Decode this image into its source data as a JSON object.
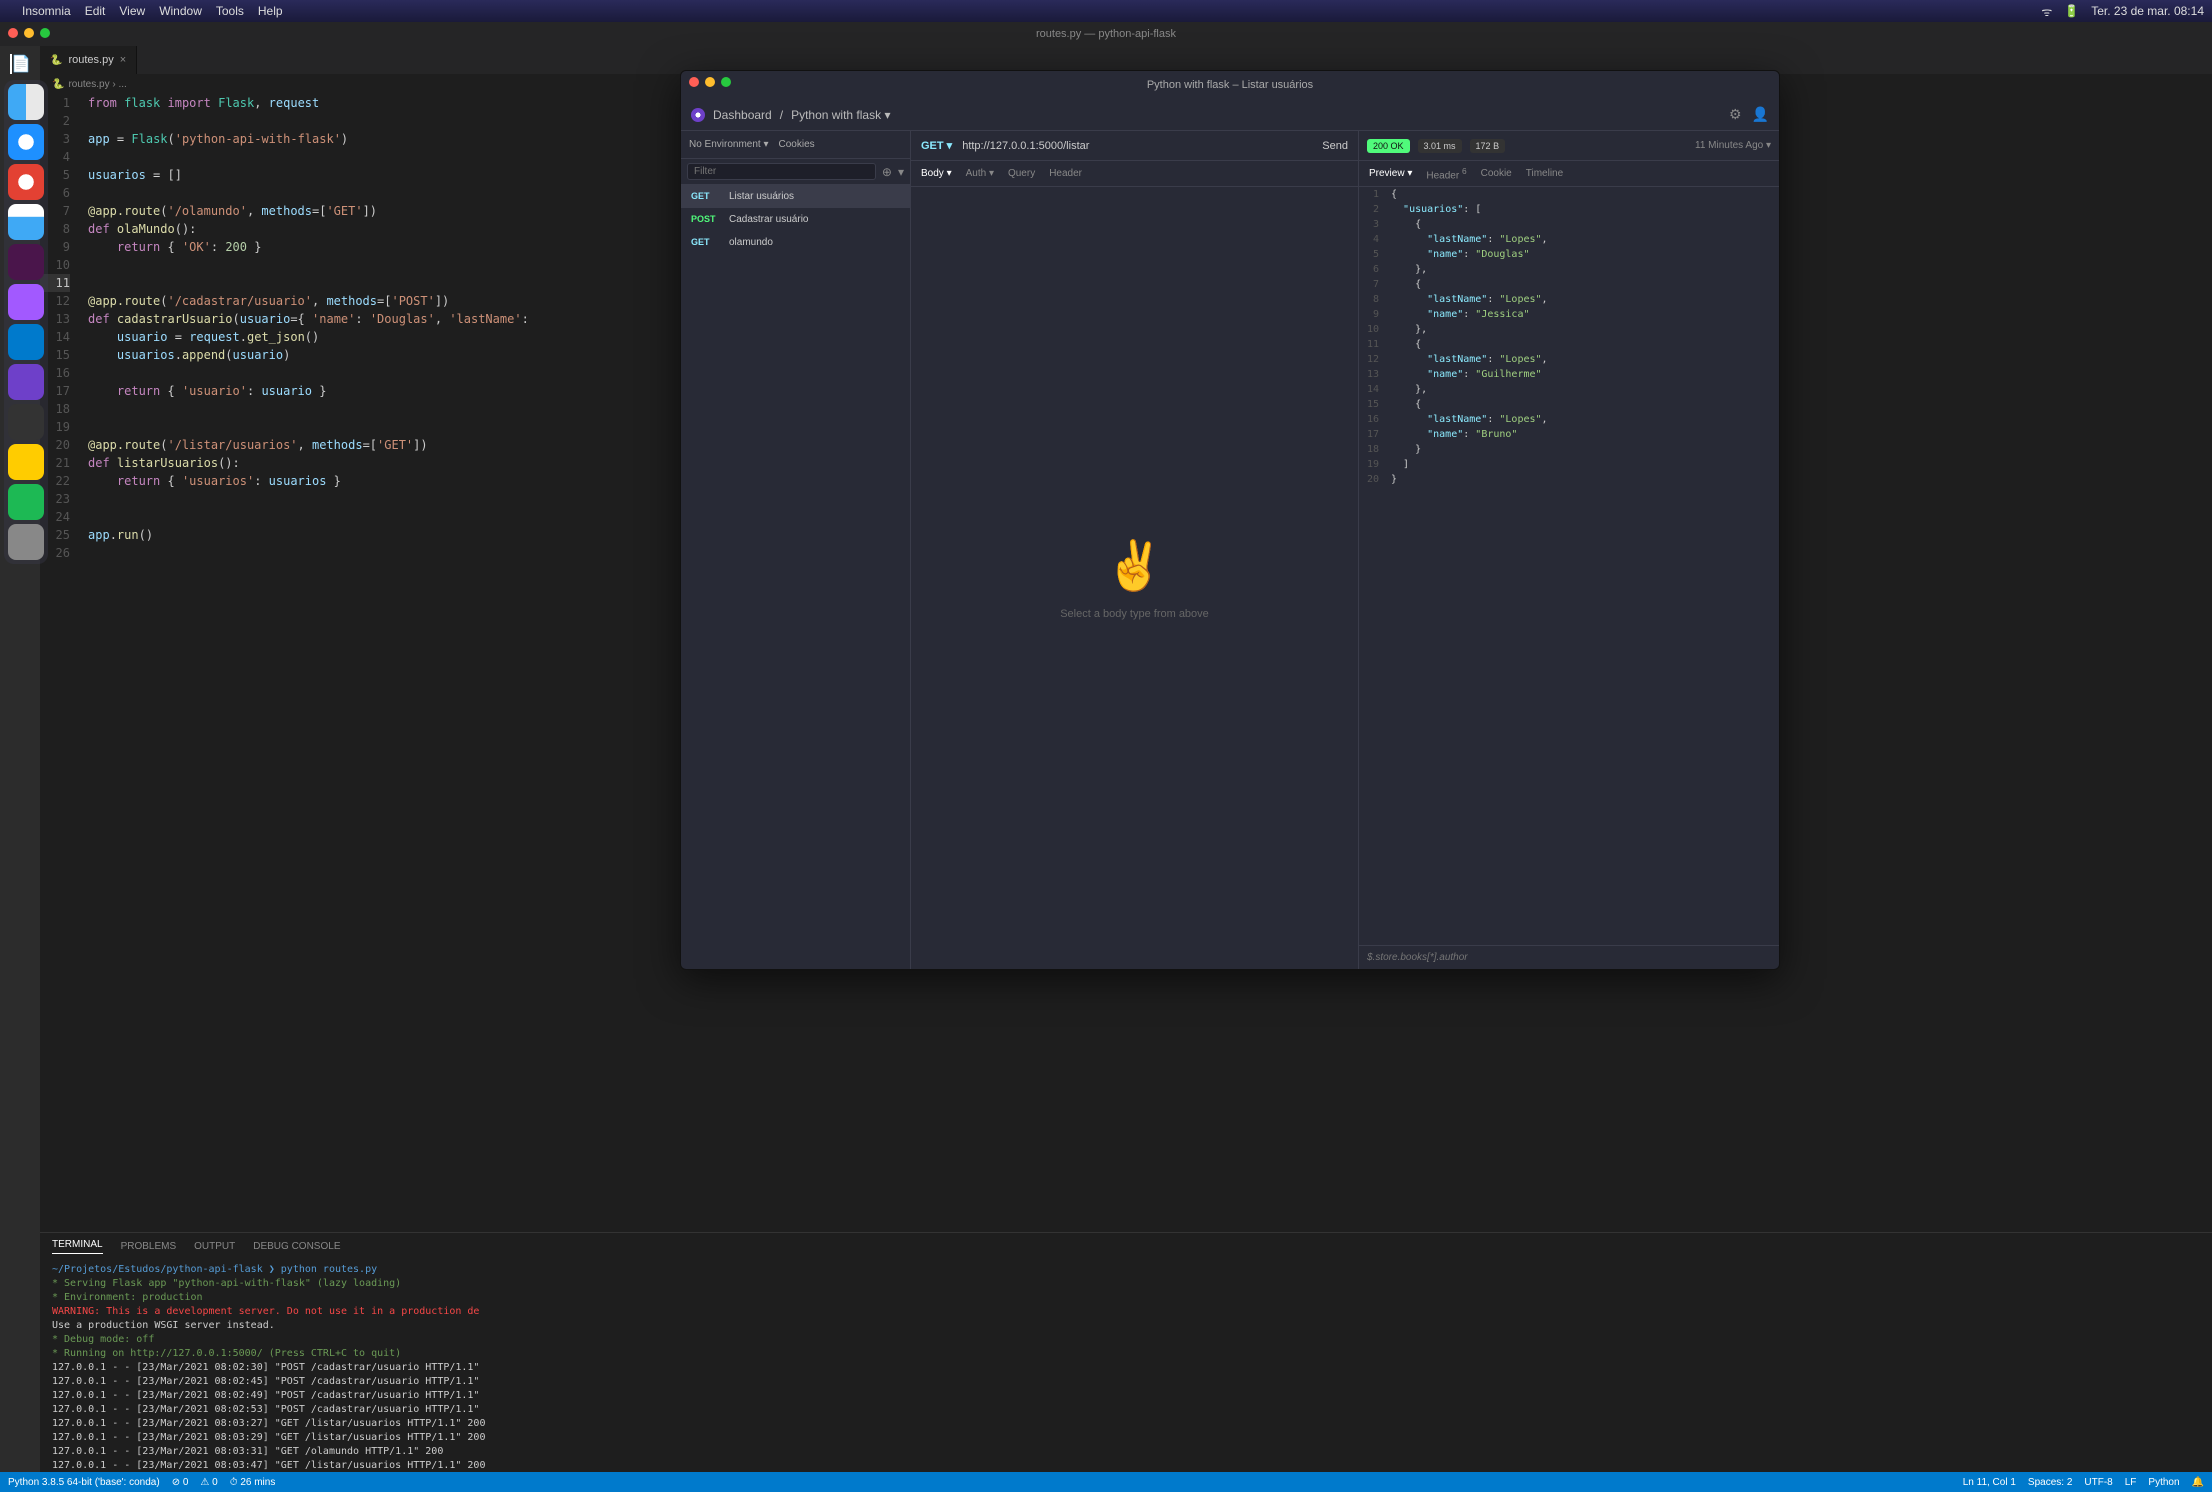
{
  "menubar": {
    "app": "Insomnia",
    "items": [
      "Edit",
      "View",
      "Window",
      "Tools",
      "Help"
    ],
    "clock": "Ter. 23 de mar. 08:14"
  },
  "vscode": {
    "title": "routes.py — python-api-flask",
    "tab": {
      "name": "routes.py",
      "breadcrumb": "routes.py › ..."
    },
    "code": {
      "1": {
        "raw": "from flask import Flask, request"
      },
      "2": {
        "raw": ""
      },
      "3": {
        "raw": "app = Flask('python-api-with-flask')"
      },
      "4": {
        "raw": ""
      },
      "5": {
        "raw": "usuarios = []"
      },
      "6": {
        "raw": ""
      },
      "7": {
        "raw": "@app.route('/olamundo', methods=['GET'])"
      },
      "8": {
        "raw": "def olaMundo():"
      },
      "9": {
        "raw": "    return { 'OK': 200 }"
      },
      "10": {
        "raw": ""
      },
      "11": {
        "raw": ""
      },
      "12": {
        "raw": "@app.route('/cadastrar/usuario', methods=['POST'])"
      },
      "13": {
        "raw": "def cadastrarUsuario(usuario={ 'name': 'Douglas', 'lastName':"
      },
      "14": {
        "raw": "    usuario = request.get_json()"
      },
      "15": {
        "raw": "    usuarios.append(usuario)"
      },
      "16": {
        "raw": ""
      },
      "17": {
        "raw": "    return { 'usuario': usuario }"
      },
      "18": {
        "raw": ""
      },
      "19": {
        "raw": ""
      },
      "20": {
        "raw": "@app.route('/listar/usuarios', methods=['GET'])"
      },
      "21": {
        "raw": "def listarUsuarios():"
      },
      "22": {
        "raw": "    return { 'usuarios': usuarios }"
      },
      "23": {
        "raw": ""
      },
      "24": {
        "raw": ""
      },
      "25": {
        "raw": "app.run()"
      },
      "26": {
        "raw": ""
      }
    },
    "terminal": {
      "tabs": [
        "TERMINAL",
        "PROBLEMS",
        "OUTPUT",
        "DEBUG CONSOLE"
      ],
      "lines": {
        "prompt": "~/Projetos/Estudos/python-api-flask ❯ python routes.py",
        "serving": " * Serving Flask app \"python-api-with-flask\" (lazy loading)",
        "env": " * Environment: production",
        "warn1": "   WARNING: This is a development server. Do not use it in a production de",
        "warn2": "   Use a production WSGI server instead.",
        "debug": " * Debug mode: off",
        "running": " * Running on http://127.0.0.1:5000/ (Press CTRL+C to quit)",
        "r1": "127.0.0.1 - - [23/Mar/2021 08:02:30] \"POST /cadastrar/usuario HTTP/1.1\"",
        "r2": "127.0.0.1 - - [23/Mar/2021 08:02:45] \"POST /cadastrar/usuario HTTP/1.1\"",
        "r3": "127.0.0.1 - - [23/Mar/2021 08:02:49] \"POST /cadastrar/usuario HTTP/1.1\"",
        "r4": "127.0.0.1 - - [23/Mar/2021 08:02:53] \"POST /cadastrar/usuario HTTP/1.1\"",
        "r5": "127.0.0.1 - - [23/Mar/2021 08:03:27] \"GET /listar/usuarios HTTP/1.1\" 200",
        "r6": "127.0.0.1 - - [23/Mar/2021 08:03:29] \"GET /listar/usuarios HTTP/1.1\" 200",
        "r7": "127.0.0.1 - - [23/Mar/2021 08:03:31] \"GET /olamundo HTTP/1.1\" 200",
        "r8": "127.0.0.1 - - [23/Mar/2021 08:03:47] \"GET /listar/usuarios HTTP/1.1\" 200"
      }
    },
    "statusbar": {
      "python": "Python 3.8.5 64-bit ('base': conda)",
      "errors": "⊘ 0",
      "warnings": "⚠ 0",
      "time": "⏱ 26 mins",
      "right": {
        "ln": "Ln 11, Col 1",
        "spaces": "Spaces: 2",
        "encoding": "UTF-8",
        "eol": "LF",
        "lang": "Python",
        "bell": "🔔"
      }
    }
  },
  "insomnia": {
    "title": "Python with flask – Listar usuários",
    "crumb_dashboard": "Dashboard",
    "crumb_sep": " / ",
    "crumb_workspace": "Python with flask ▾",
    "env": {
      "no_env": "No Environment ▾",
      "cookies": "Cookies"
    },
    "filter_placeholder": "Filter",
    "requests": [
      {
        "method": "GET",
        "name": "Listar usuários",
        "active": true
      },
      {
        "method": "POST",
        "name": "Cadastrar usuário"
      },
      {
        "method": "GET",
        "name": "olamundo"
      }
    ],
    "url": {
      "method": "GET ▾",
      "value": "http://127.0.0.1:5000/listar",
      "send": "Send"
    },
    "req_tabs": [
      "Body ▾",
      "Auth ▾",
      "Query",
      "Header"
    ],
    "body_hint": "Select a body type from above",
    "response": {
      "status": "200 OK",
      "time": "3.01 ms",
      "size": "172 B",
      "age": "11 Minutes Ago ▾",
      "tabs": [
        "Preview ▾",
        "Header",
        "Cookie",
        "Timeline"
      ],
      "header_count": "6",
      "json_lines": {
        "1": "{",
        "2": "  \"usuarios\": [",
        "3": "    {",
        "4": "      \"lastName\": \"Lopes\",",
        "5": "      \"name\": \"Douglas\"",
        "6": "    },",
        "7": "    {",
        "8": "      \"lastName\": \"Lopes\",",
        "9": "      \"name\": \"Jessica\"",
        "10": "    },",
        "11": "    {",
        "12": "      \"lastName\": \"Lopes\",",
        "13": "      \"name\": \"Guilherme\"",
        "14": "    },",
        "15": "    {",
        "16": "      \"lastName\": \"Lopes\",",
        "17": "      \"name\": \"Bruno\"",
        "18": "    }",
        "19": "  ]",
        "20": "}"
      },
      "jsonpath_placeholder": "$.store.books[*].author"
    }
  }
}
